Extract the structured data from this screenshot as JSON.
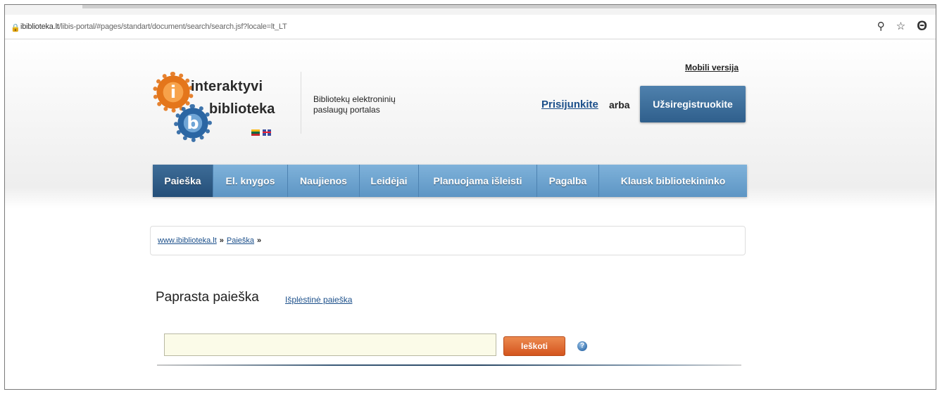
{
  "browser": {
    "url_host": "ibiblioteka.lt",
    "url_path": "/libis-portal/#pages/standart/document/search/search.jsf?locale=lt_LT"
  },
  "header": {
    "mobile_link": "Mobili versija",
    "logo_line1": "interaktyvi",
    "logo_line2": "biblioteka",
    "tagline": "Bibliotekų elektroninių paslaugų portalas",
    "login_link": "Prisijunkite",
    "or_text": "arba",
    "register_button": "Užsiregistruokite"
  },
  "nav": {
    "items": [
      {
        "label": "Paieška"
      },
      {
        "label": "El. knygos"
      },
      {
        "label": "Naujienos"
      },
      {
        "label": "Leidėjai"
      },
      {
        "label": "Planuojama išleisti"
      },
      {
        "label": "Pagalba"
      },
      {
        "label": "Klausk bibliotekininko"
      }
    ]
  },
  "breadcrumb": {
    "home": "www.ibiblioteka.lt",
    "sep": "»",
    "current": "Paieška"
  },
  "search": {
    "title": "Paprasta paieška",
    "advanced_link": "Išplėstinė paieška",
    "input_value": "",
    "button_label": "Ieškoti",
    "help_symbol": "?"
  },
  "colors": {
    "nav_bg": "#6fa3cf",
    "nav_active": "#2f5d88",
    "register_bg": "#3b6a96",
    "search_button": "#e06a2e",
    "input_bg": "#fbfbe8"
  }
}
